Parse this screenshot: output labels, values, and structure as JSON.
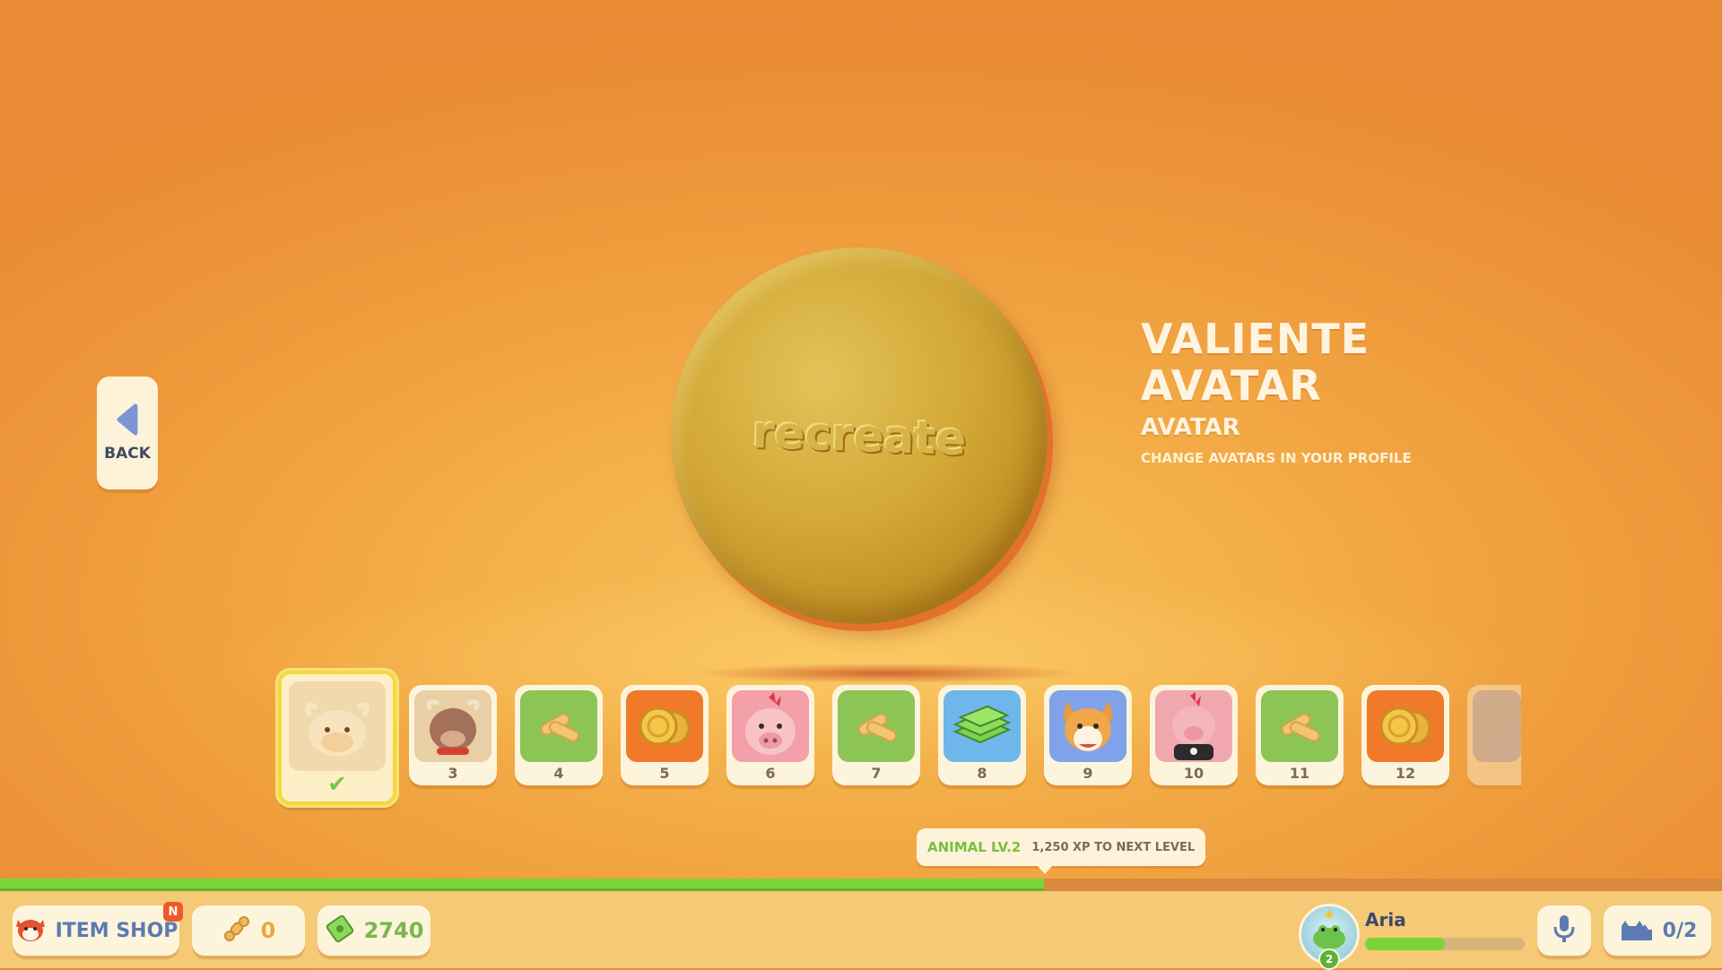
{
  "back": {
    "label": "BACK"
  },
  "coin": {
    "emboss_text": "recreate"
  },
  "item": {
    "title_line1": "VALIENTE",
    "title_line2": "AVATAR",
    "type": "AVATAR",
    "description": "CHANGE AVATARS IN YOUR PROFILE"
  },
  "carousel": {
    "selected_index": 0,
    "items": [
      {
        "num": "",
        "icon": "cow-avatar-icon",
        "selected": true
      },
      {
        "num": "3",
        "icon": "ox-avatar-icon"
      },
      {
        "num": "4",
        "icon": "bone-treats-icon"
      },
      {
        "num": "5",
        "icon": "coins-icon"
      },
      {
        "num": "6",
        "icon": "pig-avatar-icon"
      },
      {
        "num": "7",
        "icon": "bone-treats-icon"
      },
      {
        "num": "8",
        "icon": "cash-stack-icon"
      },
      {
        "num": "9",
        "icon": "corgi-avatar-icon"
      },
      {
        "num": "10",
        "icon": "punk-pig-avatar-icon"
      },
      {
        "num": "11",
        "icon": "bone-treats-icon"
      },
      {
        "num": "12",
        "icon": "coins-icon"
      },
      {
        "num": "",
        "icon": "bone-treats-icon",
        "partial": true
      }
    ]
  },
  "xp": {
    "level_label": "ANIMAL LV.2",
    "next_label": "1,250 XP TO NEXT LEVEL",
    "progress_fraction": 0.606
  },
  "bottom": {
    "item_shop_label": "ITEM SHOP",
    "item_shop_badge": "N",
    "bones_value": "0",
    "cash_value": "2740",
    "player_name": "Aria",
    "player_level": "2",
    "player_progress_fraction": 0.5,
    "party_count": "0/2"
  },
  "colors": {
    "xp_fill": "#7cd43b",
    "selected_border": "#f6d83a",
    "label_blue": "#5e7ab2"
  }
}
